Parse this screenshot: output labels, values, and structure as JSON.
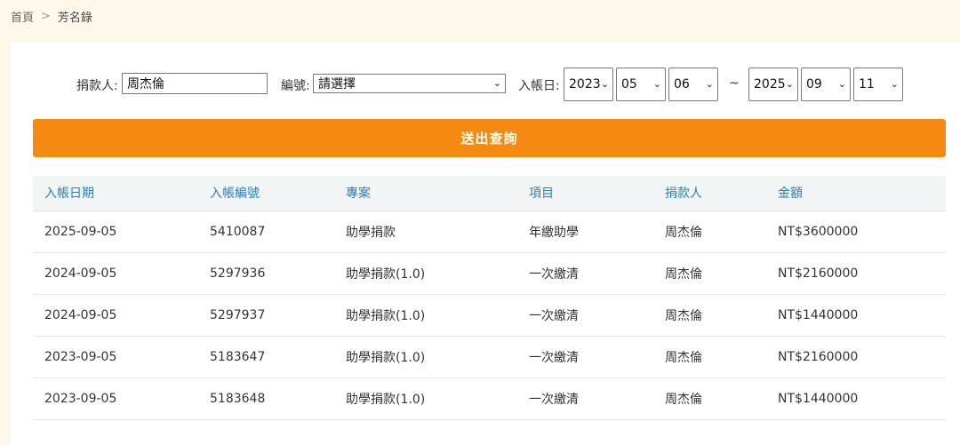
{
  "breadcrumb": {
    "home": "首頁",
    "separator": ">",
    "current": "芳名錄"
  },
  "form": {
    "donor_label": "捐款人:",
    "donor_value": "周杰倫",
    "number_label": "編號:",
    "number_value": "請選擇",
    "date_label": "入帳日:",
    "from_year": "2023",
    "from_month": "05",
    "from_day": "06",
    "range_sep": "~",
    "to_year": "2025",
    "to_month": "09",
    "to_day": "11",
    "submit_label": "送出查詢"
  },
  "table": {
    "headers": [
      "入帳日期",
      "入帳編號",
      "專案",
      "項目",
      "捐款人",
      "金額"
    ],
    "rows": [
      [
        "2025-09-05",
        "5410087",
        "助學捐款",
        "年繳助學",
        "周杰倫",
        "NT$3600000"
      ],
      [
        "2024-09-05",
        "5297936",
        "助學捐款(1.0)",
        "一次繳清",
        "周杰倫",
        "NT$2160000"
      ],
      [
        "2024-09-05",
        "5297937",
        "助學捐款(1.0)",
        "一次繳清",
        "周杰倫",
        "NT$1440000"
      ],
      [
        "2023-09-05",
        "5183647",
        "助學捐款(1.0)",
        "一次繳清",
        "周杰倫",
        "NT$2160000"
      ],
      [
        "2023-09-05",
        "5183648",
        "助學捐款(1.0)",
        "一次繳清",
        "周杰倫",
        "NT$1440000"
      ]
    ]
  },
  "colors": {
    "accent": "#f58a12",
    "header_text": "#2a7fb8",
    "page_bg": "#fdf8ea"
  }
}
